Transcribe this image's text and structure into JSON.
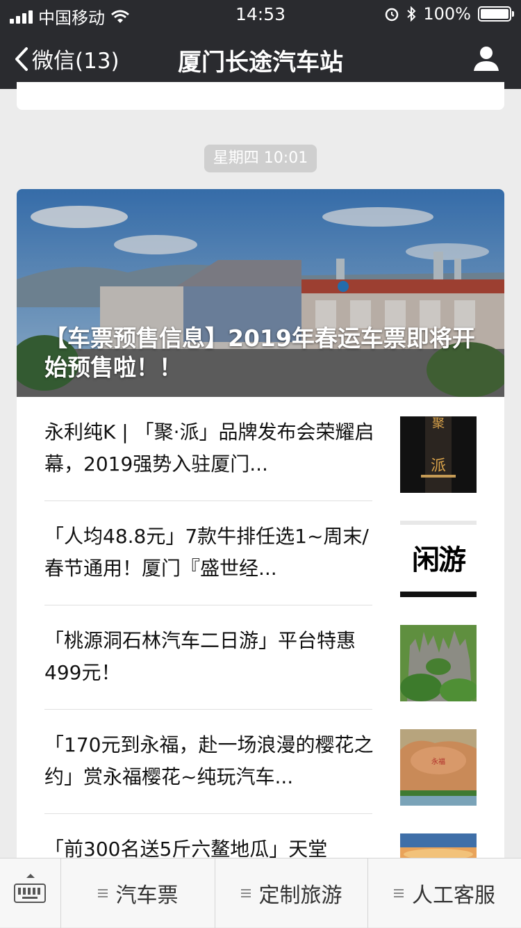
{
  "status_bar": {
    "carrier": "中国移动",
    "time": "14:53",
    "battery": "100%"
  },
  "nav": {
    "back_label": "微信(13)",
    "title": "厦门长途汽车站"
  },
  "timestamp": "星期四 10:01",
  "hero": {
    "title": "【车票预售信息】2019年春运车票即将开始预售啦！！"
  },
  "articles": [
    {
      "title": "永利纯K | 「聚·派」品牌发布会荣耀启幕，2019强势入驻厦门..."
    },
    {
      "title": "「人均48.8元」7款牛排任选1~周末/春节通用！厦门『盛世经..."
    },
    {
      "title": "「桃源洞石林汽车二日游」平台特惠499元！"
    },
    {
      "title": "「170元到永福，赴一场浪漫的樱花之约」赏永福樱花~纯玩汽车..."
    },
    {
      "title": "「前300名送5斤六鳌地瓜」天堂"
    }
  ],
  "thumb_texts": {
    "thumb2": "闲游"
  },
  "menu": {
    "items": [
      "汽车票",
      "定制旅游",
      "人工客服"
    ]
  },
  "colors": {
    "nav_bg": "#2a2b2f",
    "page_bg": "#ececec"
  }
}
